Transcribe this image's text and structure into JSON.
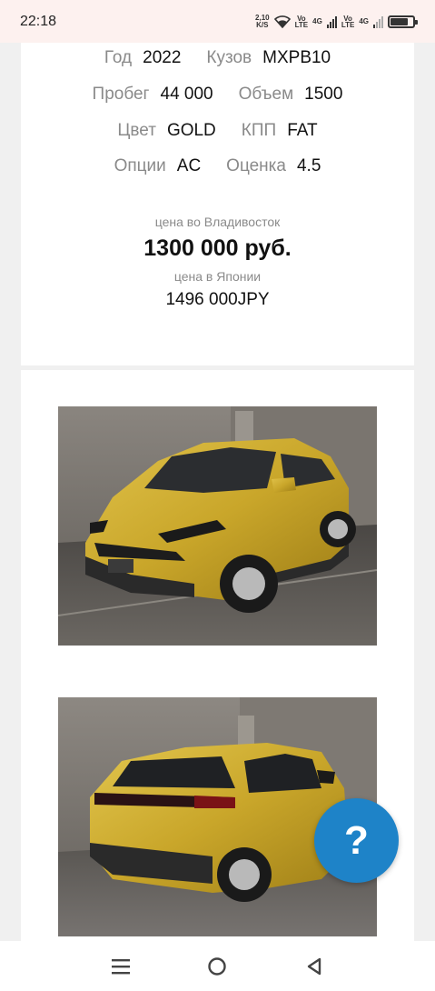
{
  "status_bar": {
    "time": "22:18",
    "net_speed_value": "2,10",
    "net_speed_unit": "K/S",
    "sim1_label_top": "Vo",
    "sim1_label_bottom": "LTE",
    "sim1_network": "4G",
    "sim2_label_top": "Vo",
    "sim2_label_bottom": "LTE",
    "sim2_network": "4G",
    "battery_level": 0.8
  },
  "specs": {
    "rows": [
      [
        {
          "label": "Год",
          "value": "2022"
        },
        {
          "label": "Кузов",
          "value": "MXPB10"
        }
      ],
      [
        {
          "label": "Пробег",
          "value": "44 000"
        },
        {
          "label": "Объем",
          "value": "1500"
        }
      ],
      [
        {
          "label": "Цвет",
          "value": "GOLD"
        },
        {
          "label": "КПП",
          "value": "FAT"
        }
      ],
      [
        {
          "label": "Опции",
          "value": "AC"
        },
        {
          "label": "Оценка",
          "value": "4.5"
        }
      ]
    ]
  },
  "price": {
    "vladivostok_caption": "цена во Владивосток",
    "vladivostok_value": "1300 000 руб.",
    "japan_caption": "цена в Японии",
    "japan_value": "1496 000JPY"
  },
  "photos": [
    {
      "icon": "car-front-photo"
    },
    {
      "icon": "car-rear-photo"
    }
  ],
  "help_button": {
    "label": "?"
  },
  "nav_bar": {
    "menu_icon": "menu-icon",
    "home_icon": "home-circle-icon",
    "back_icon": "back-triangle-icon"
  },
  "colors": {
    "help_button": "#1e83c8",
    "car_gold": "#c9a62a",
    "status_bar_bg": "#fdf1ef"
  }
}
